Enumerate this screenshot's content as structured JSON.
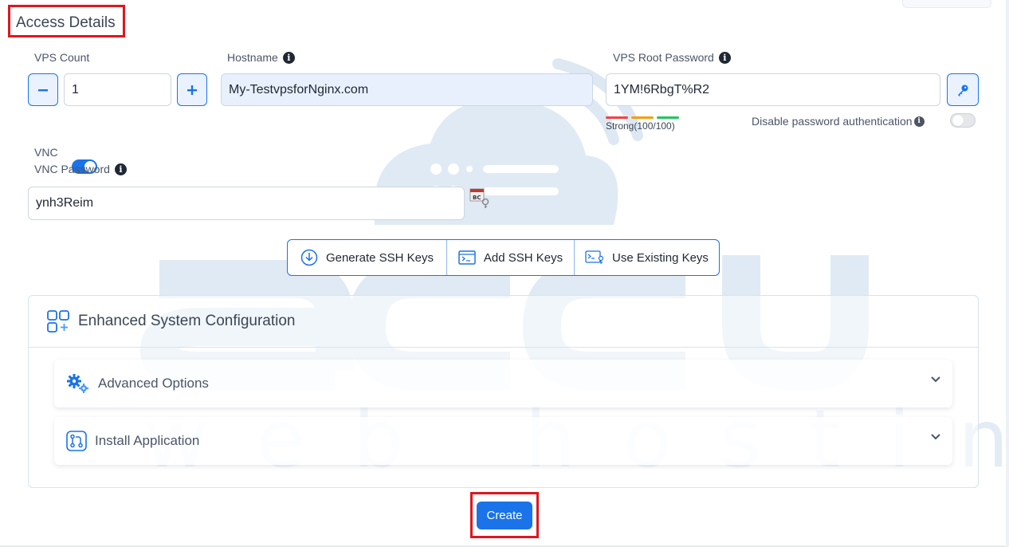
{
  "section": {
    "title": "Access Details"
  },
  "vps_count": {
    "label": "VPS Count",
    "value": "1",
    "decrement_icon": "minus-icon",
    "increment_icon": "plus-icon"
  },
  "hostname": {
    "label": "Hostname",
    "value": "My-TestvpsforNginx.com",
    "info_icon": "info-icon"
  },
  "root_password": {
    "label": "VPS Root Password",
    "value": "1YM!6RbgT%R2",
    "generate_icon": "key-icon",
    "strength_text": "Strong(100/100)",
    "strength_colors": [
      "#ef4444",
      "#f59e0b",
      "#22c55e"
    ]
  },
  "disable_password_auth": {
    "label": "Disable password authentication",
    "enabled": false
  },
  "vnc": {
    "label": "VNC",
    "enabled": true,
    "password_label": "VNC Password",
    "password_value": "ynh3Reim",
    "password_tool_icon": "password-manager-icon"
  },
  "ssh_keys": {
    "buttons": [
      {
        "label": "Generate SSH Keys",
        "icon": "download-circle-icon"
      },
      {
        "label": "Add SSH Keys",
        "icon": "terminal-icon"
      },
      {
        "label": "Use Existing Keys",
        "icon": "key-terminal-icon"
      }
    ]
  },
  "enhanced_config": {
    "title": "Enhanced System Configuration",
    "icon": "grid-plus-icon",
    "sections": [
      {
        "label": "Advanced Options",
        "icon": "gears-icon"
      },
      {
        "label": "Install Application",
        "icon": "git-branch-icon"
      }
    ]
  },
  "create_button": {
    "label": "Create"
  },
  "colors": {
    "accent": "#1a73e8",
    "highlight": "#e0161e",
    "watermark": "#e3ecf5"
  },
  "watermark": {
    "brand": "accu",
    "tagline": "web hosting"
  }
}
